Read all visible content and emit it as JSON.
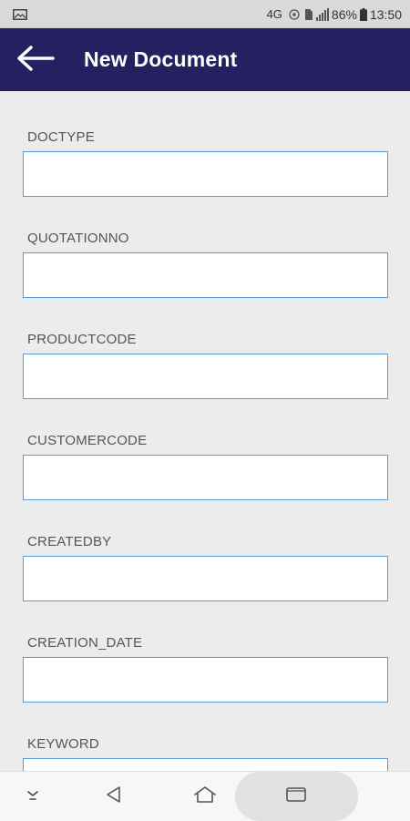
{
  "status_bar": {
    "network": "4G",
    "battery": "86%",
    "time": "13:50"
  },
  "app_bar": {
    "title": "New Document",
    "back_icon": "arrow-left-icon",
    "color": "#252160"
  },
  "form": {
    "fields": [
      {
        "label": "DOCTYPE",
        "value": ""
      },
      {
        "label": "QUOTATIONNO",
        "value": ""
      },
      {
        "label": "PRODUCTCODE",
        "value": ""
      },
      {
        "label": "CUSTOMERCODE",
        "value": ""
      },
      {
        "label": "CREATEDBY",
        "value": ""
      },
      {
        "label": "CREATION_DATE",
        "value": ""
      },
      {
        "label": "KEYWORD",
        "value": ""
      }
    ]
  },
  "nav_bar": {
    "icons": [
      "chevron-down-icon",
      "back-triangle-icon",
      "home-icon",
      "recents-icon"
    ]
  }
}
